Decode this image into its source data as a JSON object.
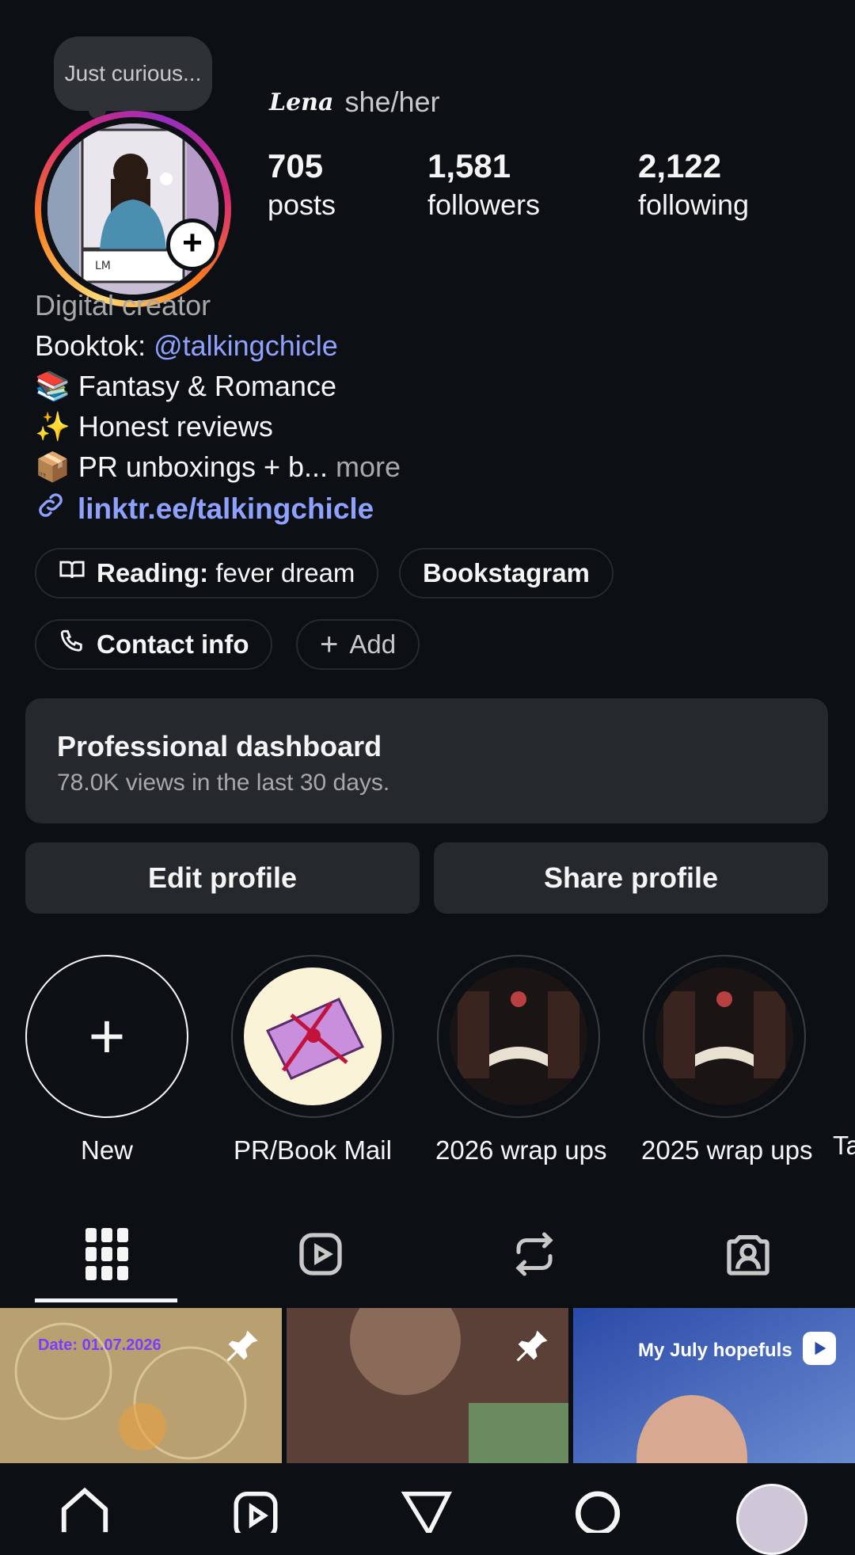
{
  "profile": {
    "note": "Just curious...",
    "display_name": "Lena",
    "pronouns": "she/her",
    "stats": [
      {
        "value": "705",
        "label": "posts"
      },
      {
        "value": "1,581",
        "label": "followers"
      },
      {
        "value": "2,122",
        "label": "following"
      }
    ],
    "category": "Digital creator",
    "bio_line1_prefix": "Booktok: ",
    "bio_mention": "@talkingchicle",
    "bio_line2": "📚 Fantasy & Romance",
    "bio_line3": "✨ Honest reviews",
    "bio_line4": "📦 PR unboxings + b...",
    "more": "more",
    "link": "linktr.ee/talkingchicle"
  },
  "chips": {
    "reading_label": "Reading:",
    "reading_value": "fever dream",
    "bookstagram": "Bookstagram",
    "contact": "Contact info",
    "add": "Add"
  },
  "dashboard": {
    "title": "Professional dashboard",
    "subtitle": "78.0K views in the last 30 days."
  },
  "buttons": {
    "edit": "Edit profile",
    "share": "Share profile"
  },
  "highlights": [
    {
      "label": "New"
    },
    {
      "label": "PR/Book Mail"
    },
    {
      "label": "2026 wrap ups"
    },
    {
      "label": "2025 wrap ups"
    },
    {
      "label": "Ta"
    }
  ],
  "posts": [
    {
      "overlay": "Date: 01.07.2026",
      "pinned": true
    },
    {
      "overlay": "",
      "pinned": true
    },
    {
      "overlay": "My July hopefuls",
      "pinned": false
    }
  ],
  "icons": [
    "grid-icon",
    "reels-icon",
    "reposts-icon",
    "tagged-icon",
    "home-icon",
    "reels-nav-icon",
    "messages-icon",
    "search-icon",
    "profile-avatar"
  ],
  "colors": {
    "background": "#0c1014",
    "link": "#8ea1ff",
    "surface": "#25292e"
  }
}
